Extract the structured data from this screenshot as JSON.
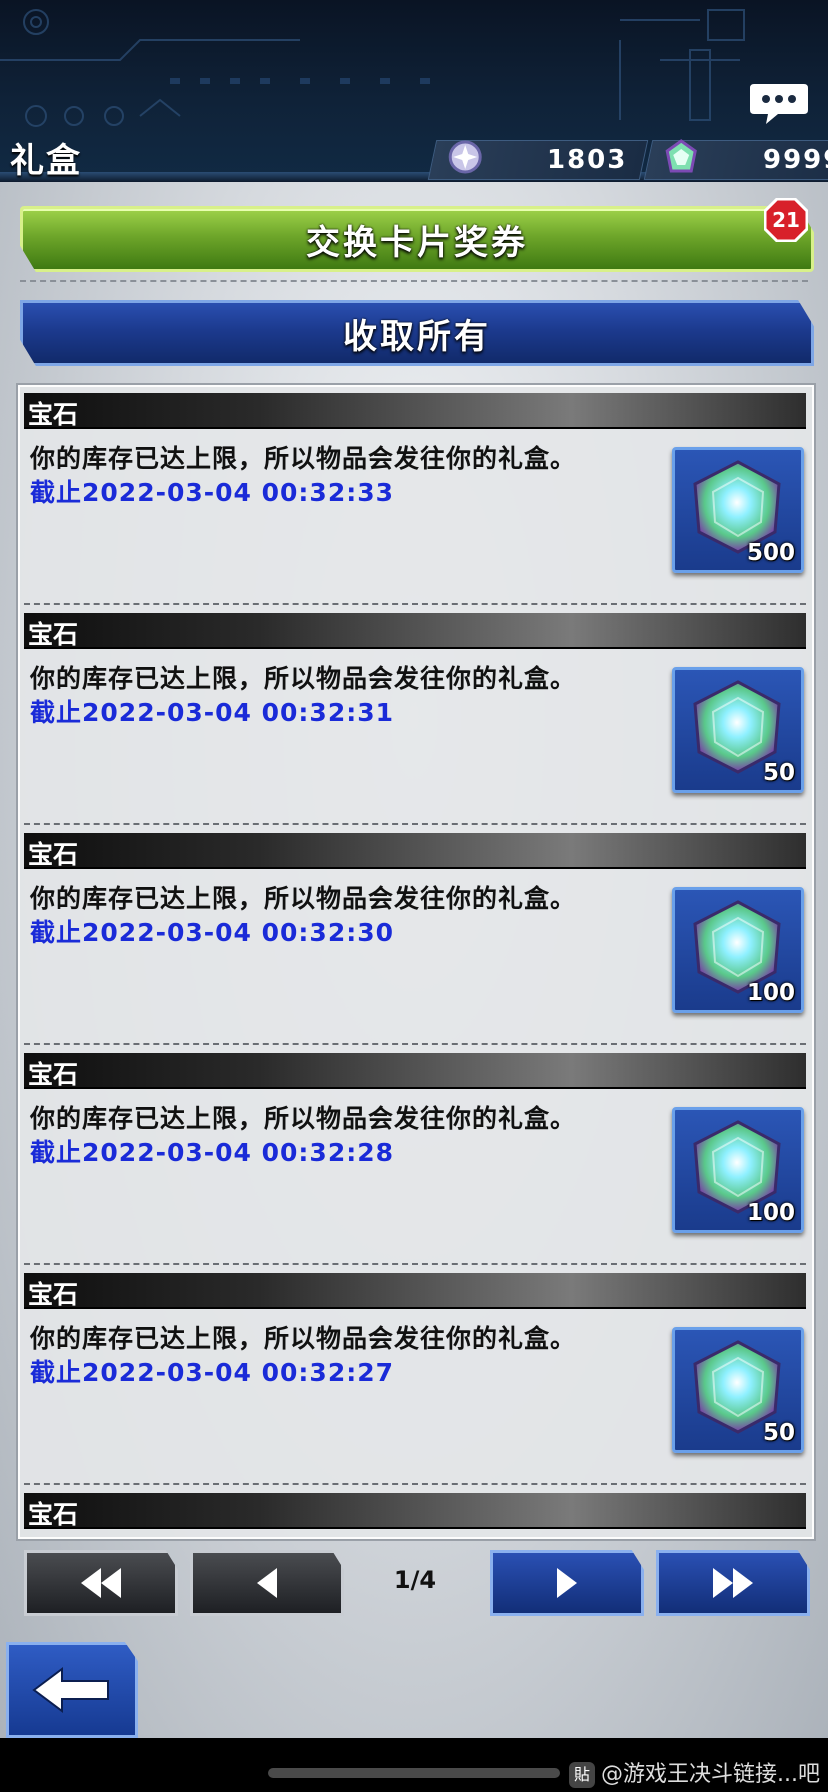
{
  "header": {
    "title": "礼盒",
    "currencies": [
      {
        "icon": "orb-currency-icon",
        "value": "1803"
      },
      {
        "icon": "gem-currency-icon",
        "value": "9999"
      }
    ]
  },
  "actions": {
    "exchange_label": "交换卡片奖券",
    "exchange_badge": "21",
    "collect_all_label": "收取所有"
  },
  "gifts": [
    {
      "category": "宝石",
      "message": "你的库存已达上限，所以物品会发往你的礼盒。",
      "deadline_prefix": "截止",
      "deadline": "2022-03-04 00:32:33",
      "quantity": "500",
      "icon": "gem-icon"
    },
    {
      "category": "宝石",
      "message": "你的库存已达上限，所以物品会发往你的礼盒。",
      "deadline_prefix": "截止",
      "deadline": "2022-03-04 00:32:31",
      "quantity": "50",
      "icon": "gem-icon"
    },
    {
      "category": "宝石",
      "message": "你的库存已达上限，所以物品会发往你的礼盒。",
      "deadline_prefix": "截止",
      "deadline": "2022-03-04 00:32:30",
      "quantity": "100",
      "icon": "gem-icon"
    },
    {
      "category": "宝石",
      "message": "你的库存已达上限，所以物品会发往你的礼盒。",
      "deadline_prefix": "截止",
      "deadline": "2022-03-04 00:32:28",
      "quantity": "100",
      "icon": "gem-icon"
    },
    {
      "category": "宝石",
      "message": "你的库存已达上限，所以物品会发往你的礼盒。",
      "deadline_prefix": "截止",
      "deadline": "2022-03-04 00:32:27",
      "quantity": "50",
      "icon": "gem-icon"
    },
    {
      "category": "宝石"
    }
  ],
  "pager": {
    "page_indicator": "1/4",
    "buttons": [
      "first-page-icon",
      "prev-page-icon",
      "next-page-icon",
      "last-page-icon"
    ]
  },
  "back_icon": "back-arrow-icon",
  "watermark": "@游戏王决斗链接...吧",
  "colors": {
    "green_button": "#6ea62a",
    "blue_button": "#1c3a8e",
    "deadline_text": "#1a2bd8",
    "badge_red": "#d8202a"
  }
}
